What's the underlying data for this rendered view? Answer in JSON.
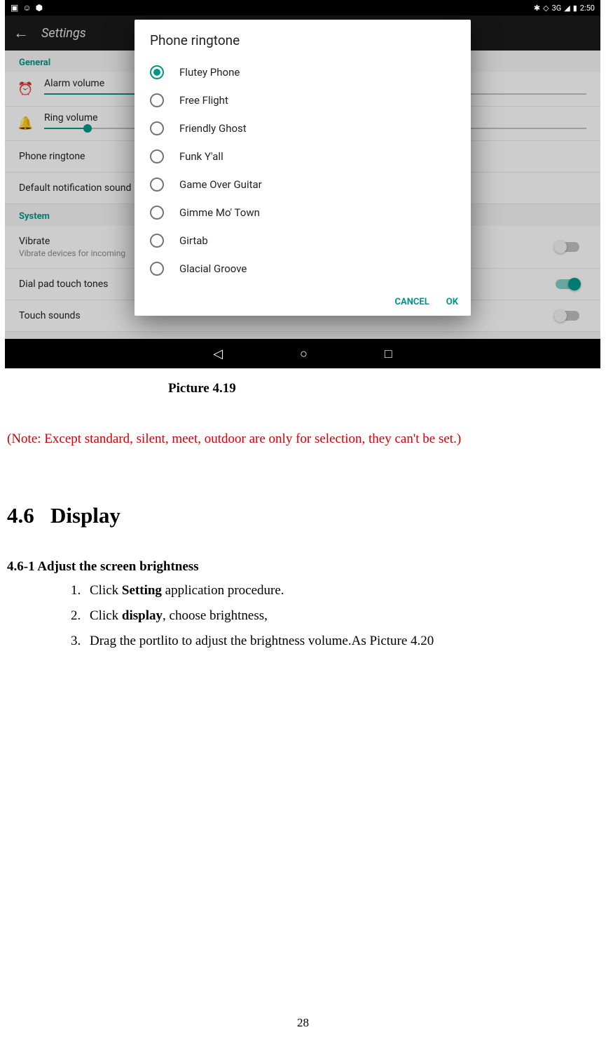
{
  "statusBar": {
    "time": "2:50",
    "network": "3G"
  },
  "header": {
    "title": "Settings"
  },
  "sections": {
    "general": "General",
    "system": "System"
  },
  "settings": {
    "alarmVolume": "Alarm volume",
    "ringVolume": "Ring volume",
    "phoneRingtone": "Phone ringtone",
    "defaultNotification": "Default notification sound",
    "vibrate": "Vibrate",
    "vibrateSub": "Vibrate devices for incoming",
    "dialPad": "Dial pad touch tones",
    "touchSounds": "Touch sounds"
  },
  "modal": {
    "title": "Phone ringtone",
    "options": [
      "Flutey Phone",
      "Free Flight",
      "Friendly Ghost",
      "Funk Y'all",
      "Game Over Guitar",
      "Gimme Mo' Town",
      "Girtab",
      "Glacial Groove"
    ],
    "selectedIndex": 0,
    "cancel": "CANCEL",
    "ok": "OK"
  },
  "doc": {
    "caption": "Picture 4.19",
    "note": "(Note: Except standard, silent, meet, outdoor are only for selection, they can't be set.)",
    "sectionNum": "4.6",
    "sectionTitle": "Display",
    "subHeading": "4.6-1 Adjust the screen brightness",
    "steps": [
      {
        "pre": "Click ",
        "bold": "Setting",
        "post": " application procedure."
      },
      {
        "pre": "Click ",
        "bold": "display",
        "post": ", choose brightness,"
      },
      {
        "pre": "Drag the portlito to adjust the brightness volume.As Picture 4.20",
        "bold": "",
        "post": ""
      }
    ],
    "pageNumber": "28"
  }
}
